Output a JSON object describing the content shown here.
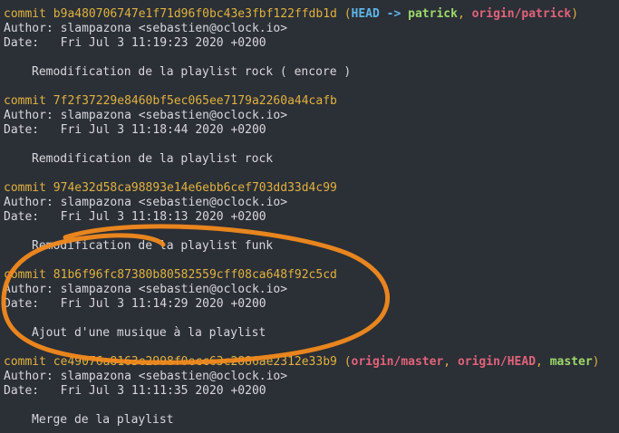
{
  "terminal": {
    "commits": [
      {
        "commit_label": "commit",
        "hash": "b9a480706747e1f71d96f0bc43e3fbf122ffdb1d",
        "refs": {
          "open": "(",
          "head": "HEAD",
          "arrow": "->",
          "local1": "patrick",
          "remote1": "origin/patrick",
          "close": ")"
        },
        "author_label": "Author:",
        "author": "slampazona <sebastien@oclock.io>",
        "date_label": "Date:",
        "date": "Fri Jul 3 11:19:23 2020 +0200",
        "message": "Remodification de la playlist rock ( encore )"
      },
      {
        "commit_label": "commit",
        "hash": "7f2f37229e8460bf5ec065ee7179a2260a44cafb",
        "author_label": "Author:",
        "author": "slampazona <sebastien@oclock.io>",
        "date_label": "Date:",
        "date": "Fri Jul 3 11:18:44 2020 +0200",
        "message": "Remodification de la playlist rock"
      },
      {
        "commit_label": "commit",
        "hash": "974e32d58ca98893e14e6ebb6cef703dd33d4c99",
        "author_label": "Author:",
        "author": "slampazona <sebastien@oclock.io>",
        "date_label": "Date:",
        "date": "Fri Jul 3 11:18:13 2020 +0200",
        "message": "Remodification de la playlist funk"
      },
      {
        "commit_label": "commit",
        "hash": "81b6f96fc87380b80582559cff08ca648f92c5cd",
        "author_label": "Author:",
        "author": "slampazona <sebastien@oclock.io>",
        "date_label": "Date:",
        "date": "Fri Jul 3 11:14:29 2020 +0200",
        "message": "Ajout d'une musique à la playlist"
      },
      {
        "commit_label": "commit",
        "hash": "ce49076a8163e2998f0ecc63c2886ae2312e33b9",
        "refs": {
          "open": "(",
          "remote1": "origin/master",
          "sep1": ",",
          "remote2": "origin/HEAD",
          "sep2": ",",
          "local1": "master",
          "close": ")"
        },
        "author_label": "Author:",
        "author": "slampazona <sebastien@oclock.io>",
        "date_label": "Date:",
        "date": "Fri Jul 3 11:11:35 2020 +0200",
        "message": "Merge de la playlist"
      }
    ],
    "colors": {
      "background": "#2b2f36",
      "text": "#d6d8dc",
      "hash": "#e0b23f",
      "head": "#5fb4e6",
      "local_branch": "#9dd86a",
      "remote_branch": "#e0637a",
      "annotation": "#f28a1e"
    }
  }
}
